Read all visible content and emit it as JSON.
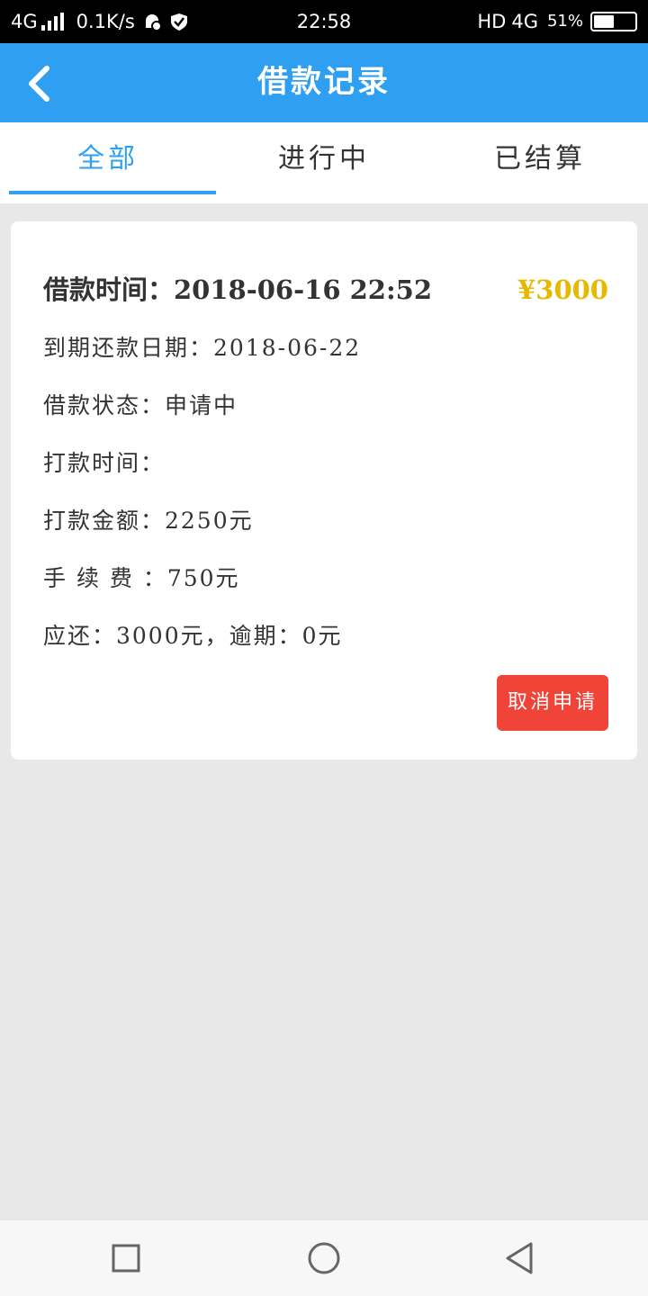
{
  "status_bar": {
    "network_left": "4G",
    "speed": "0.1K/s",
    "time": "22:58",
    "hd": "HD",
    "network_right": "4G",
    "battery": "51%"
  },
  "header": {
    "title": "借款记录",
    "back_icon": "chevron-left-icon",
    "color": "#2e9ff1"
  },
  "tabs": [
    {
      "label": "全部",
      "active": true
    },
    {
      "label": "进行中",
      "active": false
    },
    {
      "label": "已结算",
      "active": false
    }
  ],
  "record": {
    "loan_time": "借款时间：2018-06-16 22:52",
    "amount": "¥3000",
    "due_date": "到期还款日期：2018-06-22",
    "status": "借款状态：申请中",
    "payout_time": "打款时间：",
    "payout_amount": "打款金额：2250元",
    "fee": "手 续 费 ：750元",
    "repay": "应还：3000元，逾期：0元",
    "cancel_label": "取消申请"
  },
  "colors": {
    "accent": "#2e9ff1",
    "amount": "#e6b800",
    "cancel": "#f04438"
  },
  "nav_icons": [
    "square-icon",
    "circle-icon",
    "triangle-back-icon"
  ]
}
